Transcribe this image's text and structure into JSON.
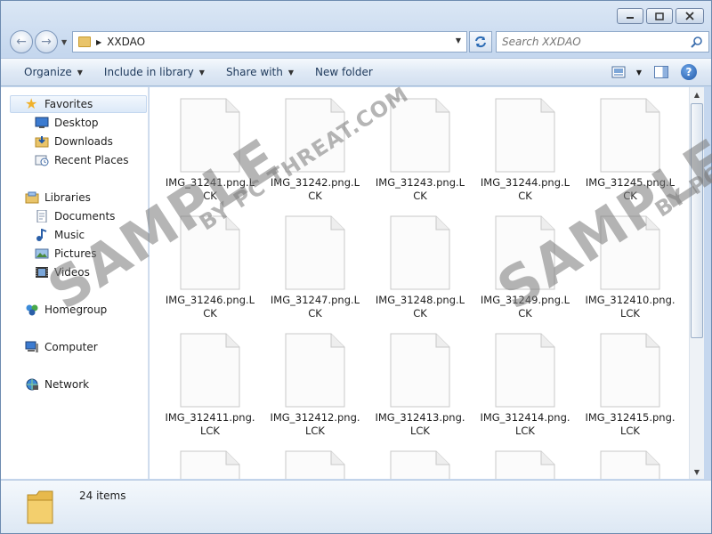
{
  "address": {
    "path": "XXDAO"
  },
  "search": {
    "placeholder": "Search XXDAO"
  },
  "toolbar": {
    "organize": "Organize",
    "include_in_library": "Include in library",
    "share_with": "Share with",
    "new_folder": "New folder"
  },
  "nav": {
    "favorites": "Favorites",
    "desktop": "Desktop",
    "downloads": "Downloads",
    "recent_places": "Recent Places",
    "libraries": "Libraries",
    "documents": "Documents",
    "music": "Music",
    "pictures": "Pictures",
    "videos": "Videos",
    "homegroup": "Homegroup",
    "computer": "Computer",
    "network": "Network"
  },
  "files": [
    "IMG_31241.png.LCK",
    "IMG_31242.png.LCK",
    "IMG_31243.png.LCK",
    "IMG_31244.png.LCK",
    "IMG_31245.png.LCK",
    "IMG_31246.png.LCK",
    "IMG_31247.png.LCK",
    "IMG_31248.png.LCK",
    "IMG_31249.png.LCK",
    "IMG_312410.png.LCK",
    "IMG_312411.png.LCK",
    "IMG_312412.png.LCK",
    "IMG_312413.png.LCK",
    "IMG_312414.png.LCK",
    "IMG_312415.png.LCK",
    "",
    "",
    "",
    "",
    ""
  ],
  "status": {
    "item_count": "24 items"
  },
  "watermark": {
    "main": "SAMPLE",
    "sub": "BY PC THREAT.COM",
    "sub_right": "BY PC"
  },
  "colors": {
    "accent": "#1e395b",
    "selection": "#dce9f8",
    "window_frame": "#c5d7ee"
  }
}
